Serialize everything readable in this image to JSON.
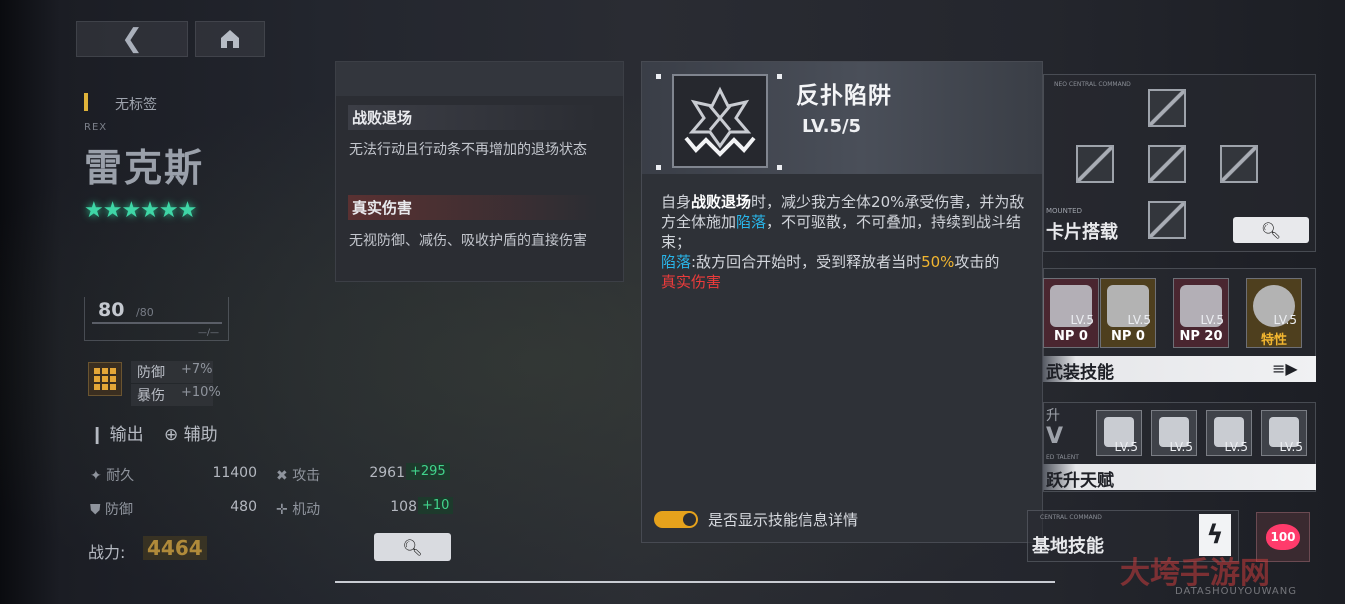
{
  "nav": {
    "back_icon": "back-chevron-icon",
    "home_icon": "home-icon"
  },
  "character": {
    "tag": "无标签",
    "en_name": "REX",
    "cn_name": "雷克斯",
    "stars": "★★★★★★",
    "level": "80",
    "level_max": "/80",
    "level_sub": "—/—",
    "buffs": [
      {
        "label": "防御",
        "value": "+7%"
      },
      {
        "label": "暴伤",
        "value": "+10%"
      }
    ],
    "roles": [
      "输出",
      "辅助"
    ],
    "stats": [
      {
        "label": "耐久",
        "value": "11400"
      },
      {
        "label": "攻击",
        "value": "2961",
        "plus": "+295"
      },
      {
        "label": "防御",
        "value": "480"
      },
      {
        "label": "机动",
        "value": "108",
        "plus": "+10"
      }
    ],
    "power_label": "战力:",
    "power_value": "4464"
  },
  "keywords": [
    {
      "title": "战败退场",
      "desc": "无法行动且行动条不再增加的退场状态"
    },
    {
      "title": "真实伤害",
      "desc": "无视防御、减伤、吸收护盾的直接伤害"
    }
  ],
  "skill": {
    "name": "反扑陷阱",
    "level": "LV.5/5",
    "desc": {
      "p1_a": "自身",
      "p1_kw": "战败退场",
      "p1_b": "时，减少我方全体20%承受伤害，并为敌方全体施加",
      "p1_kw2": "陷落",
      "p1_c": "，不可驱散，不可叠加，持续到战斗结束；",
      "p2_kw": "陷落",
      "p2_a": ":敌方回合开始时，受到释放者当时",
      "p2_pct": "50%",
      "p2_b": "攻击的",
      "p2_red": "真实伤害"
    },
    "toggle_label": "是否显示技能信息详情",
    "toggle_on": true
  },
  "right_panel": {
    "chip_section": "卡片搭载",
    "chip_top_label": "MOUNTED",
    "chip_map_caption": "NEO CENTRAL COMMAND",
    "armed_section": "武装技能",
    "armed_skills": [
      {
        "lv": "LV.5",
        "bottom": "NP  0"
      },
      {
        "lv": "LV.5",
        "bottom": "NP  0"
      },
      {
        "lv": "LV.5",
        "bottom": "NP 20"
      },
      {
        "lv": "LV.5",
        "bottom": "特性"
      }
    ],
    "ascend_title": "升",
    "ascend_sub": "V",
    "ascend_caption": "ED TALENT",
    "ascend_section": "跃升天赋",
    "ascend_skills": [
      {
        "lv": "LV.5"
      },
      {
        "lv": "LV.5"
      },
      {
        "lv": "LV.5"
      },
      {
        "lv": "LV.5"
      }
    ],
    "base_caption": "CENTRAL COMMAND",
    "base_section": "基地技能",
    "heart_value": "100"
  },
  "watermark": {
    "text": "大垮手游网",
    "sub": "DATASHOUYOUWANG"
  },
  "colors": {
    "accent_gold": "#e6a21c",
    "keyword_blue": "#29b6ea",
    "true_damage_red": "#ec3b3b",
    "stat_plus_green": "#41d48c",
    "star_green": "#3fd6a6"
  }
}
